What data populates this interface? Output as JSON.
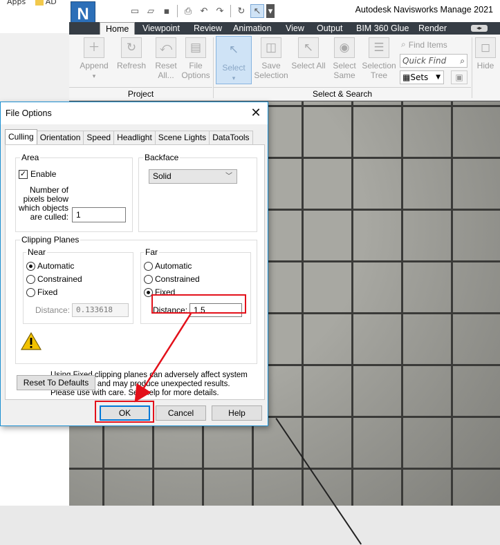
{
  "explorer": {
    "crumb_1": "Apps",
    "crumb_2": "AD"
  },
  "app": {
    "title": "Autodesk Navisworks Manage 2021",
    "logo_letter": "N",
    "tabs": [
      "Home",
      "Viewpoint",
      "Review",
      "Animation",
      "View",
      "Output",
      "BIM 360 Glue",
      "Render"
    ],
    "active_tab": "Home"
  },
  "ribbon": {
    "append": "Append",
    "refresh": "Refresh",
    "reset_all": "Reset All...",
    "file_options": "File Options",
    "select": "Select",
    "save_selection": "Save Selection",
    "select_all": "Select All",
    "select_same": "Select Same",
    "selection_tree": "Selection Tree",
    "find_items": "Find Items",
    "quick_find_placeholder": "Quick Find",
    "sets": "Sets",
    "hide": "Hide",
    "panel_project": "Project",
    "panel_select_search": "Select & Search"
  },
  "dialog": {
    "title": "File Options",
    "close": "✕",
    "tabs": [
      "Culling",
      "Orientation",
      "Speed",
      "Headlight",
      "Scene Lights",
      "DataTools"
    ],
    "area": {
      "label": "Area",
      "enable": "Enable",
      "enable_checked": true,
      "pixels_label_1": "Number of",
      "pixels_label_2": "pixels below",
      "pixels_label_3": "which objects",
      "pixels_label_4": "are culled:",
      "pixels_value": "1"
    },
    "backface": {
      "label": "Backface",
      "value": "Solid"
    },
    "clipping": {
      "label": "Clipping Planes",
      "near": {
        "label": "Near",
        "options": [
          "Automatic",
          "Constrained",
          "Fixed"
        ],
        "selected": "Automatic",
        "distance_label": "Distance:",
        "distance_value": "0.133618"
      },
      "far": {
        "label": "Far",
        "options": [
          "Automatic",
          "Constrained",
          "Fixed"
        ],
        "selected": "Fixed",
        "distance_label": "Distance:",
        "distance_value": "1.5"
      }
    },
    "warning": "Using Fixed clipping planes can adversely affect system performance and may produce unexpected results. Please use with care. See help for more details.",
    "reset_button": "Reset To Defaults",
    "ok_button": "OK",
    "cancel_button": "Cancel",
    "help_button": "Help"
  },
  "colors": {
    "highlight": "#e3101a",
    "accent": "#0078d7",
    "tabbar": "#363d45"
  }
}
